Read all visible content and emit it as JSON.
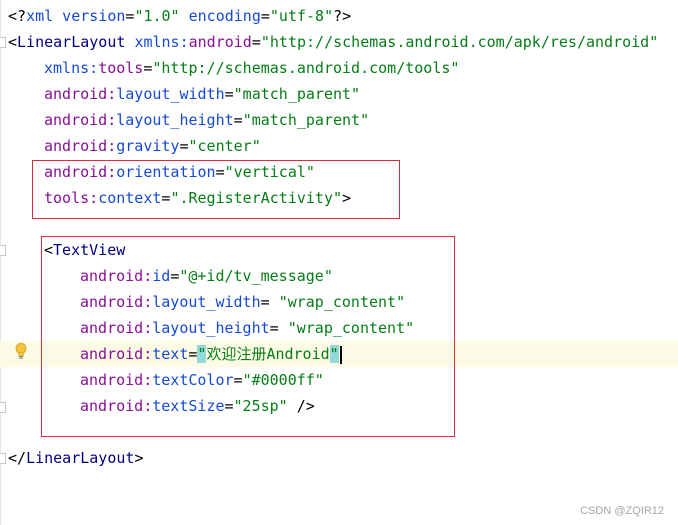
{
  "code": {
    "l1": {
      "a": "<?",
      "b": "xml version",
      "c": "=",
      "d": "\"1.0\"",
      "e": " encoding",
      "f": "=",
      "g": "\"utf-8\"",
      "h": "?>"
    },
    "l2": {
      "open": "<",
      "tag": "LinearLayout",
      "ns": "xmlns:",
      "attr": "android",
      "eq": "=",
      "val": "\"http://schemas.android.com/apk/res/android\""
    },
    "l3": {
      "ns": "xmlns:",
      "attr": "tools",
      "eq": "=",
      "val": "\"http://schemas.android.com/tools\""
    },
    "l4": {
      "ns": "android:",
      "attr": "layout_width",
      "eq": "=",
      "val": "\"match_parent\""
    },
    "l5": {
      "ns": "android:",
      "attr": "layout_height",
      "eq": "=",
      "val": "\"match_parent\""
    },
    "l6": {
      "ns": "android:",
      "attr": "gravity",
      "eq": "=",
      "val": "\"center\""
    },
    "l7": {
      "ns": "android:",
      "attr": "orientation",
      "eq": "=",
      "val": "\"vertical\""
    },
    "l8": {
      "ns": "tools:",
      "attr": "context",
      "eq": "=",
      "val": "\".RegisterActivity\"",
      "close": ">"
    },
    "l10": {
      "open": "<",
      "tag": "TextView"
    },
    "l11": {
      "ns": "android:",
      "attr": "id",
      "eq": "=",
      "val": "\"@+id/tv_message\""
    },
    "l12": {
      "ns": "android:",
      "attr": "layout_width",
      "eq": "= ",
      "val": "\"wrap_content\""
    },
    "l13": {
      "ns": "android:",
      "attr": "layout_height",
      "eq": "= ",
      "val": "\"wrap_content\""
    },
    "l14": {
      "ns": "android:",
      "attr": "text",
      "eq": "=",
      "q1": "\"",
      "val": "欢迎注册Android",
      "q2": "\""
    },
    "l15": {
      "ns": "android:",
      "attr": "textColor",
      "eq": "=",
      "val": "\"#0000ff\""
    },
    "l16": {
      "ns": "android:",
      "attr": "textSize",
      "eq": "=",
      "val": "\"25sp\"",
      "close": " />"
    },
    "l18": {
      "open": "</",
      "tag": "LinearLayout",
      "close": ">"
    }
  },
  "watermark": "CSDN @ZQIR12",
  "colors": {
    "highlight_box": "#d0313c",
    "line_highlight": "#fdfbe6",
    "brace_match": "#93d9d9"
  },
  "icons": {
    "intention": "lightbulb-icon"
  }
}
